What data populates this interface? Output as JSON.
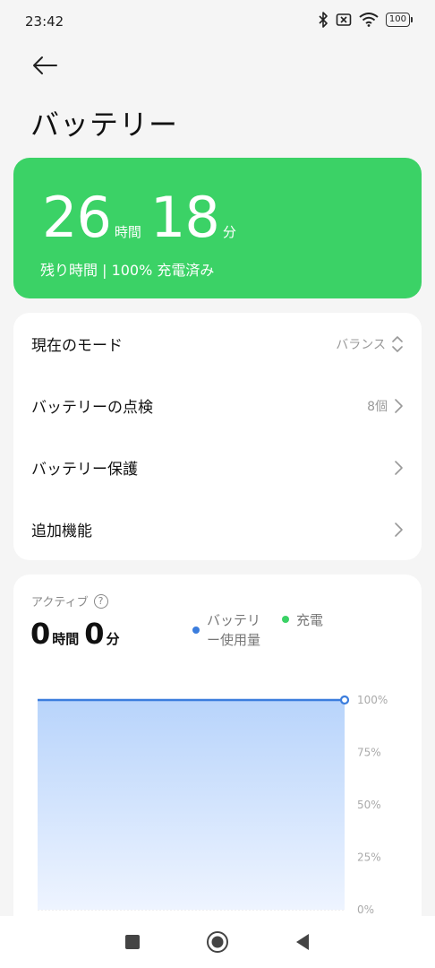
{
  "status_bar": {
    "time": "23:42",
    "battery_level": "100",
    "icons": [
      "bluetooth-icon",
      "no-sim-icon",
      "wifi-icon",
      "battery-icon"
    ]
  },
  "header": {
    "back_icon": "arrow-left-icon",
    "title": "バッテリー"
  },
  "hero": {
    "hours": "26",
    "hours_unit": "時間",
    "minutes": "18",
    "minutes_unit": "分",
    "subtitle": "残り時間 | 100% 充電済み",
    "color": "#3bd266"
  },
  "settings": [
    {
      "label": "現在のモード",
      "value": "バランス",
      "icon": "up-down-chevron-icon"
    },
    {
      "label": "バッテリーの点検",
      "value": "8個",
      "icon": "chevron-right-icon"
    },
    {
      "label": "バッテリー保護",
      "value": "",
      "icon": "chevron-right-icon"
    },
    {
      "label": "追加機能",
      "value": "",
      "icon": "chevron-right-icon"
    }
  ],
  "usage": {
    "active_label": "アクティブ",
    "help_icon": "?",
    "hours": "0",
    "hours_unit": "時間",
    "minutes": "0",
    "minutes_unit": "分",
    "legend": [
      {
        "name": "バッテリー使用量",
        "line1": "バッテリ",
        "line2": "ー使用量",
        "color": "#3b7ddd"
      },
      {
        "name": "充電",
        "color": "#3bd266"
      }
    ]
  },
  "chart_data": {
    "type": "area",
    "y_ticks": [
      "100%",
      "75%",
      "50%",
      "25%",
      "0%"
    ],
    "ylim": [
      0,
      100
    ],
    "series": [
      {
        "name": "バッテリー使用量",
        "x": [
          0,
          1
        ],
        "values": [
          100,
          100
        ],
        "color": "#3b7ddd"
      }
    ],
    "grid": true
  },
  "nav": {
    "icons": [
      "recent-apps-icon",
      "home-icon",
      "back-triangle-icon"
    ]
  }
}
